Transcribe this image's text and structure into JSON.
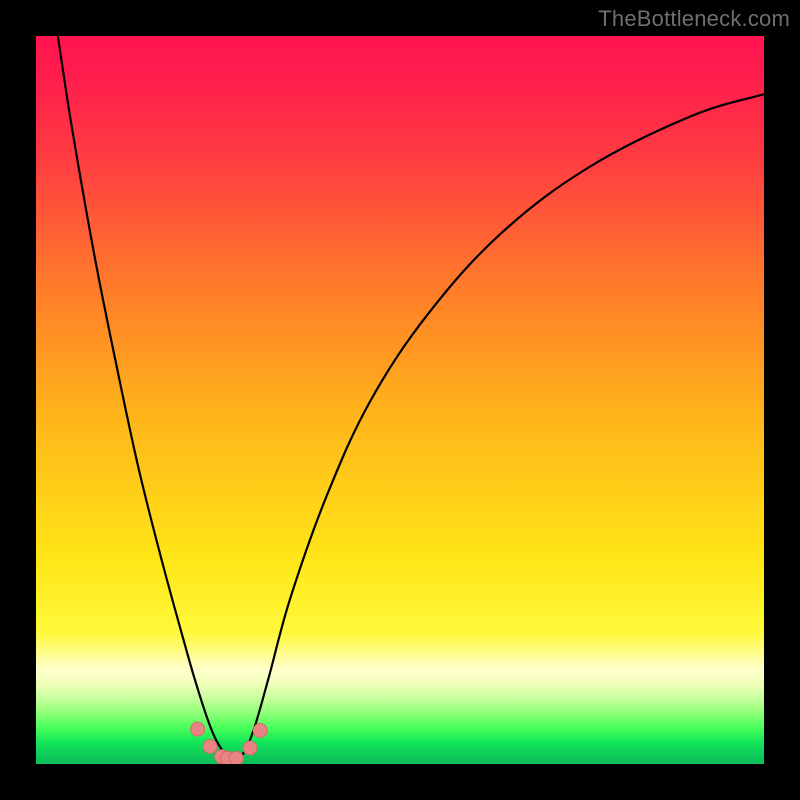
{
  "watermark": "TheBottleneck.com",
  "colors": {
    "frame": "#000000",
    "curve": "#000000",
    "marker_fill": "#e88482",
    "marker_stroke": "#d46b68"
  },
  "chart_data": {
    "type": "line",
    "title": "",
    "xlabel": "",
    "ylabel": "",
    "xlim": [
      0,
      100
    ],
    "ylim": [
      0,
      100
    ],
    "grid": false,
    "legend": false,
    "note": "Axes are unlabeled; values estimated from curve position using 0–100 normalized coordinates (y=0 bottom, y=100 top). Curve is a V-shaped bottleneck profile with minimum near x≈27.",
    "series": [
      {
        "name": "bottleneck-curve",
        "x": [
          3,
          5,
          8,
          11,
          14,
          17,
          20,
          22,
          24,
          25.5,
          27,
          28.5,
          30,
          32,
          35,
          40,
          46,
          54,
          64,
          76,
          90,
          100
        ],
        "y": [
          100,
          87,
          70,
          55,
          41,
          29,
          18,
          11,
          5,
          2,
          0.3,
          1.5,
          5,
          12,
          23,
          37,
          50,
          62,
          73,
          82,
          89,
          92
        ]
      }
    ],
    "markers": {
      "name": "highlighted-points",
      "x": [
        22.2,
        23.9,
        25.5,
        26.3,
        27.5,
        29.4,
        30.8
      ],
      "y": [
        4.8,
        2.4,
        1.0,
        0.8,
        0.8,
        2.2,
        4.6
      ]
    }
  }
}
